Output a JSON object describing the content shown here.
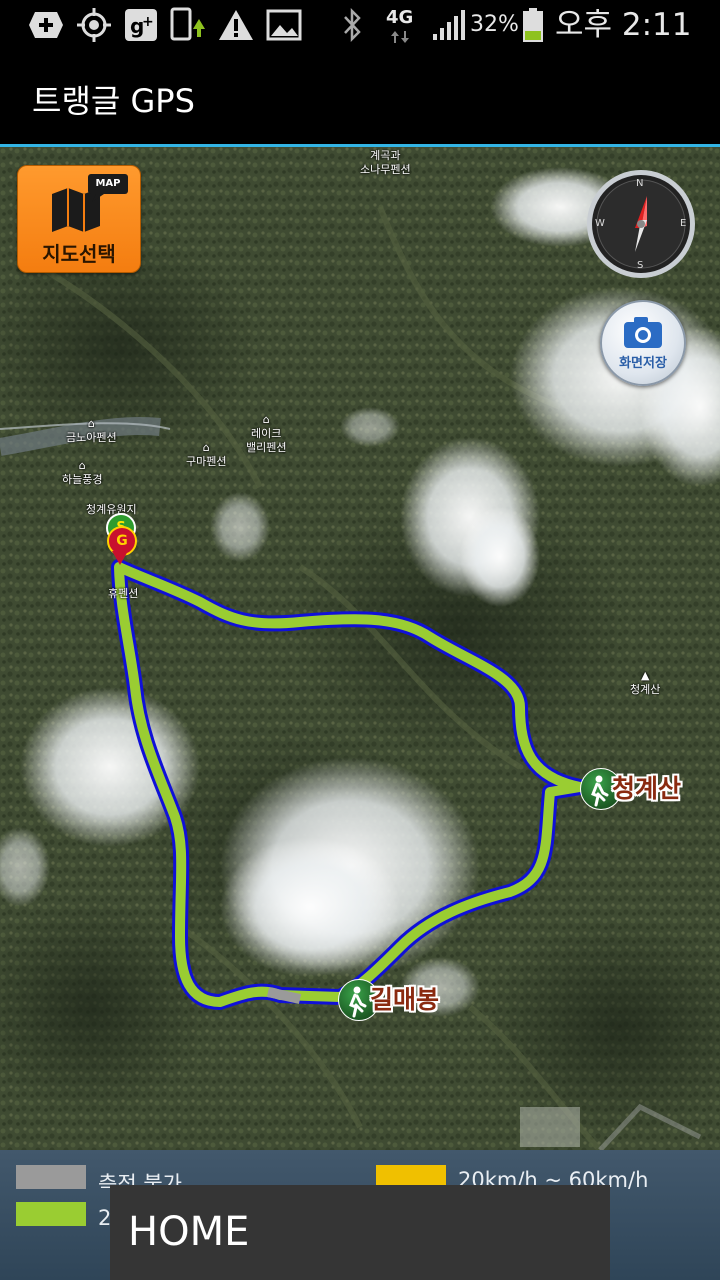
{
  "status_bar": {
    "icons": [
      "add-icon",
      "gps-icon",
      "google-plus-icon",
      "phone-update-icon",
      "warning-icon",
      "image-icon",
      "bluetooth-icon",
      "signal-icon",
      "battery-icon"
    ],
    "network": "4G",
    "battery": "32%",
    "time": "오후 2:11",
    "battery_level": 0.32,
    "battery_color": "#8ec21f"
  },
  "app": {
    "title": "트랭글 GPS",
    "accent": "#33b5e5"
  },
  "map": {
    "select_button": {
      "label": "지도선택",
      "badge": "MAP"
    },
    "capture_button": {
      "label": "화면저장"
    },
    "compass": {
      "n": "N",
      "s": "S",
      "e": "E",
      "w": "W"
    },
    "pois": [
      "계곡과\n소나무펜션",
      "레이크\n밸리펜션",
      "금노아펜션",
      "하늘풍경",
      "구마펜션",
      "청계유원지",
      "휴펜션",
      "청계산"
    ],
    "peaks": [
      "청계산",
      "길매봉"
    ],
    "start_marker": "S",
    "goal_marker": "G",
    "track_color": "#9acd32",
    "track_outline": "#1010d8"
  },
  "legend": {
    "items": [
      {
        "label": "측정 불가",
        "color": "#9a9a9a"
      },
      {
        "label": "20km/h ~ 60km/h",
        "color": "#f0c000"
      },
      {
        "label": "2",
        "color": "#9acd32"
      }
    ]
  },
  "toast": {
    "text": "HOME"
  }
}
